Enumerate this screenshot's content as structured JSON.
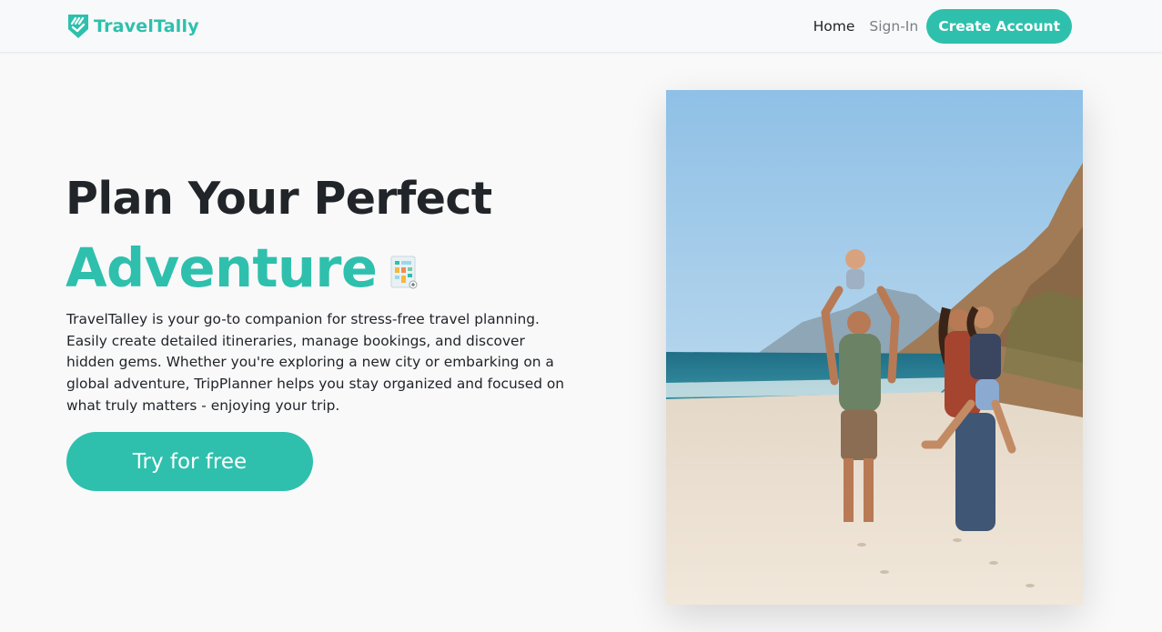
{
  "header": {
    "brand": "TravelTally",
    "nav": {
      "home": "Home",
      "sign_in": "Sign-In",
      "create_account": "Create Account"
    }
  },
  "hero": {
    "title_line1": "Plan Your Perfect",
    "title_line2": "Adventure",
    "description": "TravelTalley is your go-to companion for stress-free travel planning. Easily create detailed itineraries, manage bookings, and discover hidden gems. Whether you're exploring a new city or embarking on a global adventure, TripPlanner helps you stay organized and focused on what truly matters - enjoying your trip.",
    "cta": "Try for free",
    "image_icon": "planner-icon",
    "photo_icon": "beach-family-photo"
  },
  "colors": {
    "accent": "#2ec0ad",
    "text": "#212529",
    "muted": "#7a7f85",
    "background": "#f9f9fa"
  },
  "icons": {
    "logo": "checkmark-shield-icon"
  }
}
